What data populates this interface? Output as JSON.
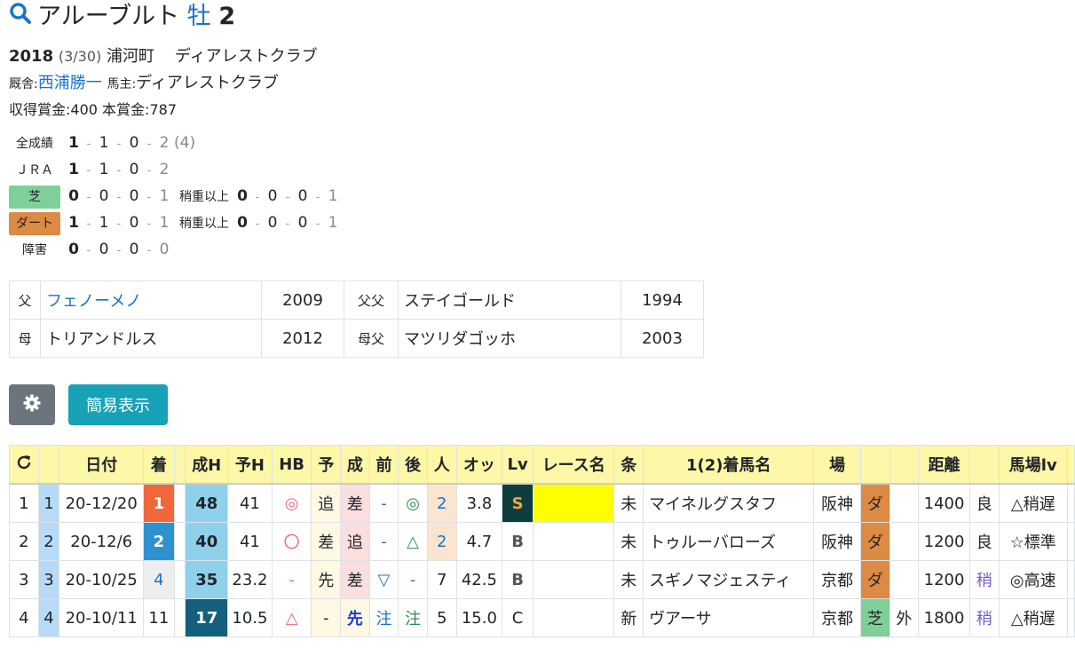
{
  "horse": {
    "name": "アルーブルト",
    "sex": "牡",
    "age": "2"
  },
  "profile": {
    "birth_year": "2018",
    "birth_date": "(3/30)",
    "breeder_place": "浦河町",
    "breeder": "ディアレストクラブ",
    "trainer_label": "厩舎:",
    "trainer": "西浦勝一",
    "owner_label": "馬主:",
    "owner": "ディアレストクラブ",
    "prize_label": "収得賞金:",
    "prize": "400",
    "main_prize_label": "本賞金:",
    "main_prize": "787"
  },
  "records": [
    {
      "label": "全成績",
      "vals": [
        "1",
        "1",
        "0",
        "2"
      ],
      "note": "(4)"
    },
    {
      "label": "ＪＲＡ",
      "vals": [
        "1",
        "1",
        "0",
        "2"
      ]
    },
    {
      "label": "芝",
      "vals": [
        "0",
        "0",
        "0",
        "1"
      ],
      "sub_label": "稍重以上",
      "sub_vals": [
        "0",
        "0",
        "0",
        "1"
      ]
    },
    {
      "label": "ダート",
      "vals": [
        "1",
        "1",
        "0",
        "1"
      ],
      "sub_label": "稍重以上",
      "sub_vals": [
        "0",
        "0",
        "0",
        "1"
      ]
    },
    {
      "label": "障害",
      "vals": [
        "0",
        "0",
        "0",
        "0"
      ]
    }
  ],
  "pedigree": {
    "sire_label": "父",
    "sire": "フェノーメノ",
    "sire_year": "2009",
    "sire_sire_label": "父父",
    "sire_sire": "ステイゴールド",
    "sire_sire_year": "1994",
    "dam_label": "母",
    "dam": "トリアンドルス",
    "dam_year": "2012",
    "dam_sire_label": "母父",
    "dam_sire": "マツリダゴッホ",
    "dam_sire_year": "2003"
  },
  "buttons": {
    "settings_icon": "gear-icon",
    "simple": "簡易表示"
  },
  "results": {
    "headers": [
      "",
      "",
      "日付",
      "着",
      "",
      "成H",
      "予H",
      "HB",
      "予",
      "成",
      "前",
      "後",
      "人",
      "オッ",
      "Lv",
      "レース名",
      "条",
      "1(2)着馬名",
      "場",
      "",
      "",
      "距離",
      "",
      "馬場lv",
      ""
    ],
    "rows": [
      {
        "no": "1",
        "idx": "1",
        "date": "20-12/20",
        "rank": "1",
        "sH": "48",
        "yH": "41",
        "hb": "◎",
        "yo": "追",
        "sei": "差",
        "mae": "-",
        "ato": "◎",
        "pop": "2",
        "odds": "3.8",
        "lv": "S",
        "race": "",
        "cond": "未",
        "horse": "マイネルグスタフ",
        "course": "阪神",
        "surface": "ダ",
        "inout": "",
        "dist": "1400",
        "going": "良",
        "baba": "△稍遅"
      },
      {
        "no": "2",
        "idx": "2",
        "date": "20-12/6",
        "rank": "2",
        "sH": "40",
        "yH": "41",
        "hb": "〇",
        "yo": "差",
        "sei": "追",
        "mae": "-",
        "ato": "△",
        "pop": "2",
        "odds": "4.7",
        "lv": "B",
        "race": "",
        "cond": "未",
        "horse": "トゥルーバローズ",
        "course": "阪神",
        "surface": "ダ",
        "inout": "",
        "dist": "1200",
        "going": "良",
        "baba": "☆標準"
      },
      {
        "no": "3",
        "idx": "3",
        "date": "20-10/25",
        "rank": "4",
        "sH": "35",
        "yH": "23.2",
        "hb": "-",
        "yo": "先",
        "sei": "差",
        "mae": "▽",
        "ato": "-",
        "pop": "7",
        "odds": "42.5",
        "lv": "B",
        "race": "",
        "cond": "未",
        "horse": "スギノマジェスティ",
        "course": "京都",
        "surface": "ダ",
        "inout": "",
        "dist": "1200",
        "going": "稍",
        "baba": "◎高速"
      },
      {
        "no": "4",
        "idx": "4",
        "date": "20-10/11",
        "rank": "11",
        "sH": "17",
        "yH": "10.5",
        "hb": "△",
        "yo": "-",
        "sei": "先",
        "mae": "注",
        "ato": "注",
        "pop": "5",
        "odds": "15.0",
        "lv": "C",
        "race": "",
        "cond": "新",
        "horse": "ヴアーサ",
        "course": "京都",
        "surface": "芝",
        "inout": "外",
        "dist": "1800",
        "going": "稍",
        "baba": "△稍遅"
      }
    ]
  }
}
